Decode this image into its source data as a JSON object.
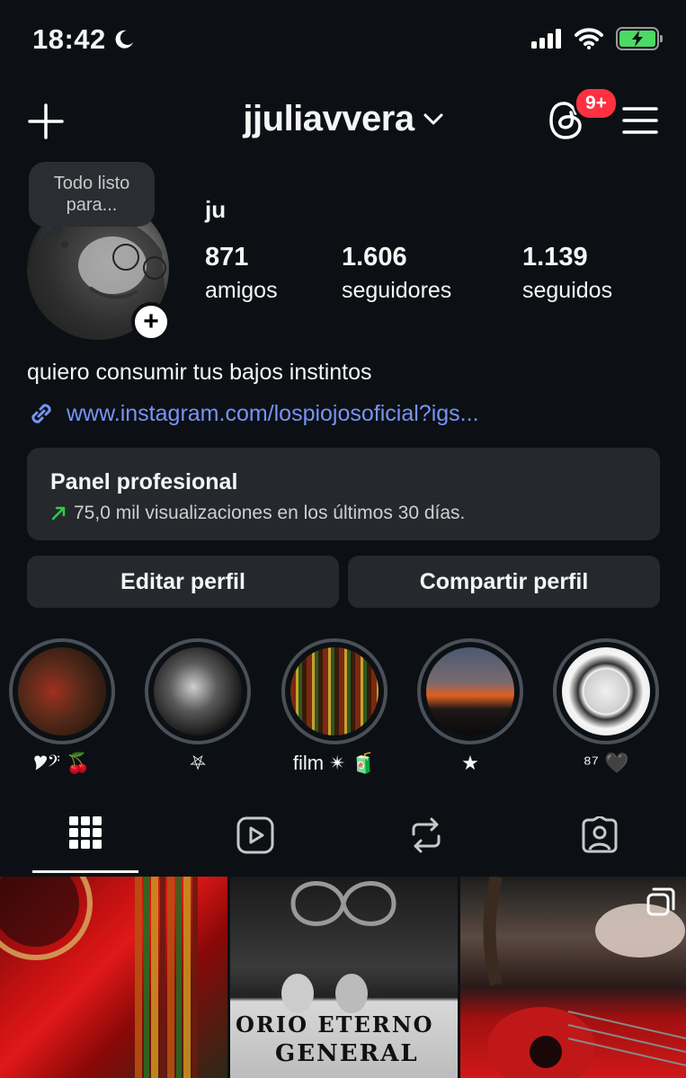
{
  "status_bar": {
    "time": "18:42"
  },
  "header": {
    "username": "jjuliavvera",
    "notification_badge": "9+"
  },
  "profile": {
    "note": "Todo listo para...",
    "display_name": "ju",
    "stats": [
      {
        "value": "871",
        "label": "amigos"
      },
      {
        "value": "1.606",
        "label": "seguidores"
      },
      {
        "value": "1.139",
        "label": "seguidos"
      }
    ],
    "bio": "quiero consumir tus bajos instintos",
    "link": "www.instagram.com/lospiojosoficial?igs..."
  },
  "panel": {
    "title": "Panel profesional",
    "subtitle": "75,0 mil visualizaciones en los últimos 30 días."
  },
  "buttons": {
    "edit": "Editar perfil",
    "share": "Compartir perfil"
  },
  "highlights": [
    {
      "label": "🎔𝄢 🍒"
    },
    {
      "label": "⛧"
    },
    {
      "label": "film ✴ 🧃"
    },
    {
      "label": "★"
    },
    {
      "label": "⁸⁷ 🖤"
    }
  ],
  "grid": {
    "banner_line1": "ORIO ETERNO",
    "banner_line2": "GENERAL"
  },
  "icons": [
    "moon-icon",
    "signal-icon",
    "wifi-icon",
    "battery-icon",
    "plus-icon",
    "chevron-down-icon",
    "threads-icon",
    "menu-icon",
    "link-icon",
    "trend-arrow-icon",
    "grid-icon",
    "reels-icon",
    "reposts-icon",
    "tagged-icon",
    "multi-post-icon"
  ],
  "colors": {
    "background": "#0c1014",
    "link": "#7893f5",
    "badge": "#ff3040",
    "battery": "#4cd964",
    "trend": "#35c84a"
  }
}
